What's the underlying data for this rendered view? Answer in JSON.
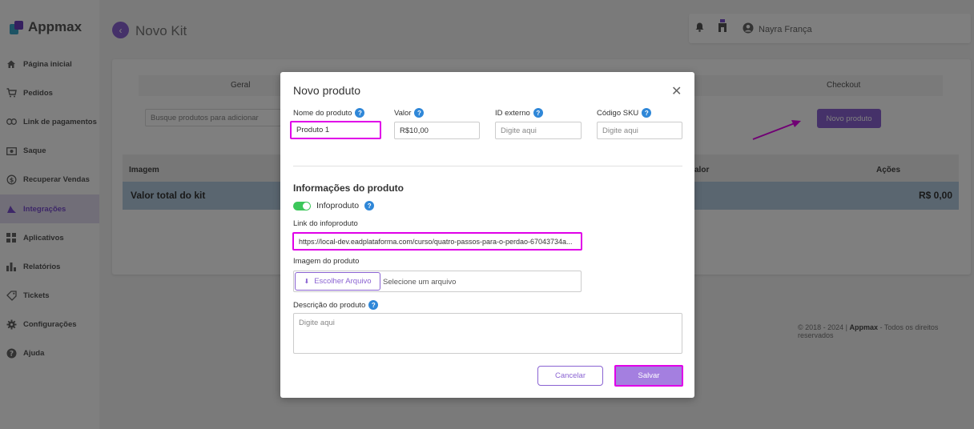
{
  "app": {
    "name": "Appmax"
  },
  "sidebar": {
    "items": [
      {
        "label": "Página inicial",
        "icon": "home-icon"
      },
      {
        "label": "Pedidos",
        "icon": "cart-icon"
      },
      {
        "label": "Link de pagamentos",
        "icon": "link-icon"
      },
      {
        "label": "Saque",
        "icon": "cash-icon"
      },
      {
        "label": "Recuperar Vendas",
        "icon": "recover-icon"
      },
      {
        "label": "Integrações",
        "icon": "integrations-icon",
        "active": true
      },
      {
        "label": "Aplicativos",
        "icon": "apps-icon"
      },
      {
        "label": "Relatórios",
        "icon": "chart-icon"
      },
      {
        "label": "Tickets",
        "icon": "ticket-icon"
      },
      {
        "label": "Configurações",
        "icon": "gear-icon"
      },
      {
        "label": "Ajuda",
        "icon": "help-icon"
      }
    ]
  },
  "header": {
    "title": "Novo Kit",
    "user": "Nayra França"
  },
  "main": {
    "tabs": [
      "Geral",
      "Checkout"
    ],
    "search_placeholder": "Busque produtos para adicionar",
    "new_product_button": "Novo produto",
    "table": {
      "col_image": "Imagem",
      "col_value": "alor",
      "col_actions": "Ações"
    },
    "total_label": "Valor total do kit",
    "total_value": "R$ 0,00"
  },
  "footer": {
    "prefix": "© 2018 - 2024 | ",
    "brand": "Appmax",
    "suffix": " - Todos os direitos reservados"
  },
  "modal": {
    "title": "Novo produto",
    "fields": {
      "name_label": "Nome do produto",
      "name_value": "Produto 1",
      "value_label": "Valor",
      "value_value": "R$10,00",
      "external_id_label": "ID externo",
      "external_id_placeholder": "Digite aqui",
      "sku_label": "Código SKU",
      "sku_placeholder": "Digite aqui"
    },
    "section_title": "Informações do produto",
    "infoproduct_toggle_label": "Infoproduto",
    "infoproduct_enabled": true,
    "link_label": "Link do infoproduto",
    "link_value": "https://local-dev.eadplataforma.com/curso/quatro-passos-para-o-perdao-67043734a...",
    "image_label": "Imagem do produto",
    "choose_file_button": "Escolher Arquivo",
    "file_status": "Selecione um arquivo",
    "description_label": "Descrição do produto",
    "description_placeholder": "Digite aqui",
    "cancel_button": "Cancelar",
    "save_button": "Salvar"
  },
  "colors": {
    "accent": "#8a63d2",
    "highlight": "#e000e8",
    "toggle_on": "#3cc75a",
    "help": "#2f87d8"
  }
}
